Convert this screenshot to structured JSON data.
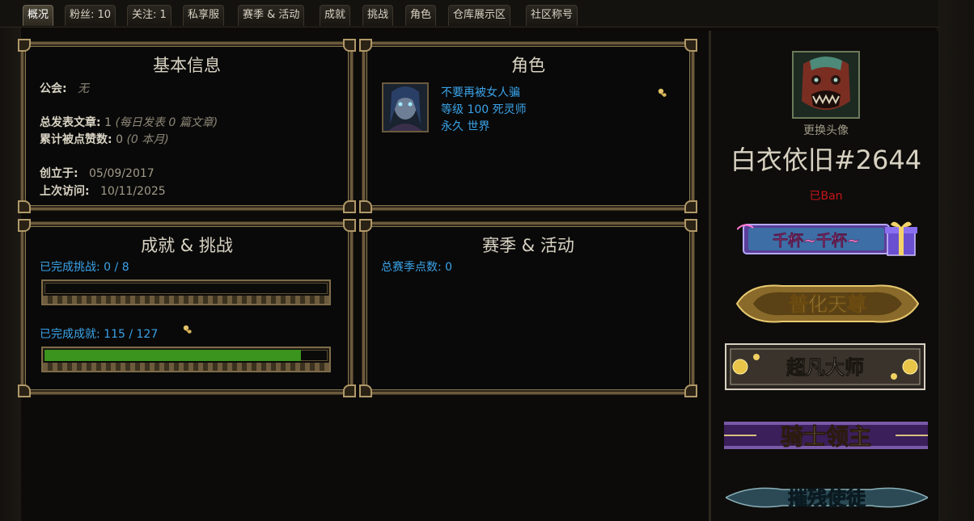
{
  "tabs": [
    {
      "label": "概况",
      "active": true
    },
    {
      "label": "粉丝: 10"
    },
    {
      "label": "关注: 1"
    },
    {
      "label": "私享服"
    },
    {
      "label": "赛季 & 活动"
    },
    {
      "label": "成就"
    },
    {
      "label": "挑战"
    },
    {
      "label": "角色"
    },
    {
      "label": "仓库展示区"
    },
    {
      "label": "社区称号"
    }
  ],
  "basic_info": {
    "title": "基本信息",
    "guild_label": "公会:",
    "guild_value": "无",
    "posts_label": "总发表文章:",
    "posts_value": "1",
    "posts_note": "(每日发表 0 篇文章)",
    "likes_label": "累计被点赞数:",
    "likes_value": "0",
    "likes_note": "(0 本月)",
    "created_label": "创立于:",
    "created_value": "05/09/2017",
    "last_visit_label": "上次访问:",
    "last_visit_value": "10/11/2025"
  },
  "character": {
    "title": "角色",
    "name": "不要再被女人骗",
    "level_line": "等级 100 死灵师",
    "league_line": "永久 世界"
  },
  "achievements": {
    "title": "成就 & 挑战",
    "challenges_label": "已完成挑战:",
    "challenges_value": "0 / 8",
    "challenges_progress": 0.0,
    "achievements_label": "已完成成就:",
    "achievements_value": "115 / 127",
    "achievements_progress": 0.906
  },
  "season": {
    "title": "赛季 & 活动",
    "points_label": "总赛季点数:",
    "points_value": "0"
  },
  "profile": {
    "change_avatar": "更换头像",
    "username": "白衣依旧#2644",
    "status": "已Ban"
  },
  "badges": [
    {
      "text": "千杯~千杯~",
      "icon": "gift-box-icon"
    },
    {
      "text": "普化天尊"
    },
    {
      "text": "超凡大师"
    },
    {
      "text": "骑士领主"
    },
    {
      "text": "摧残使徒"
    }
  ],
  "colors": {
    "link_blue": "#3aa3e8",
    "progress_green": "#3a941e",
    "banned_red": "#c8141a",
    "frame_gold": "#6b5a3c"
  }
}
